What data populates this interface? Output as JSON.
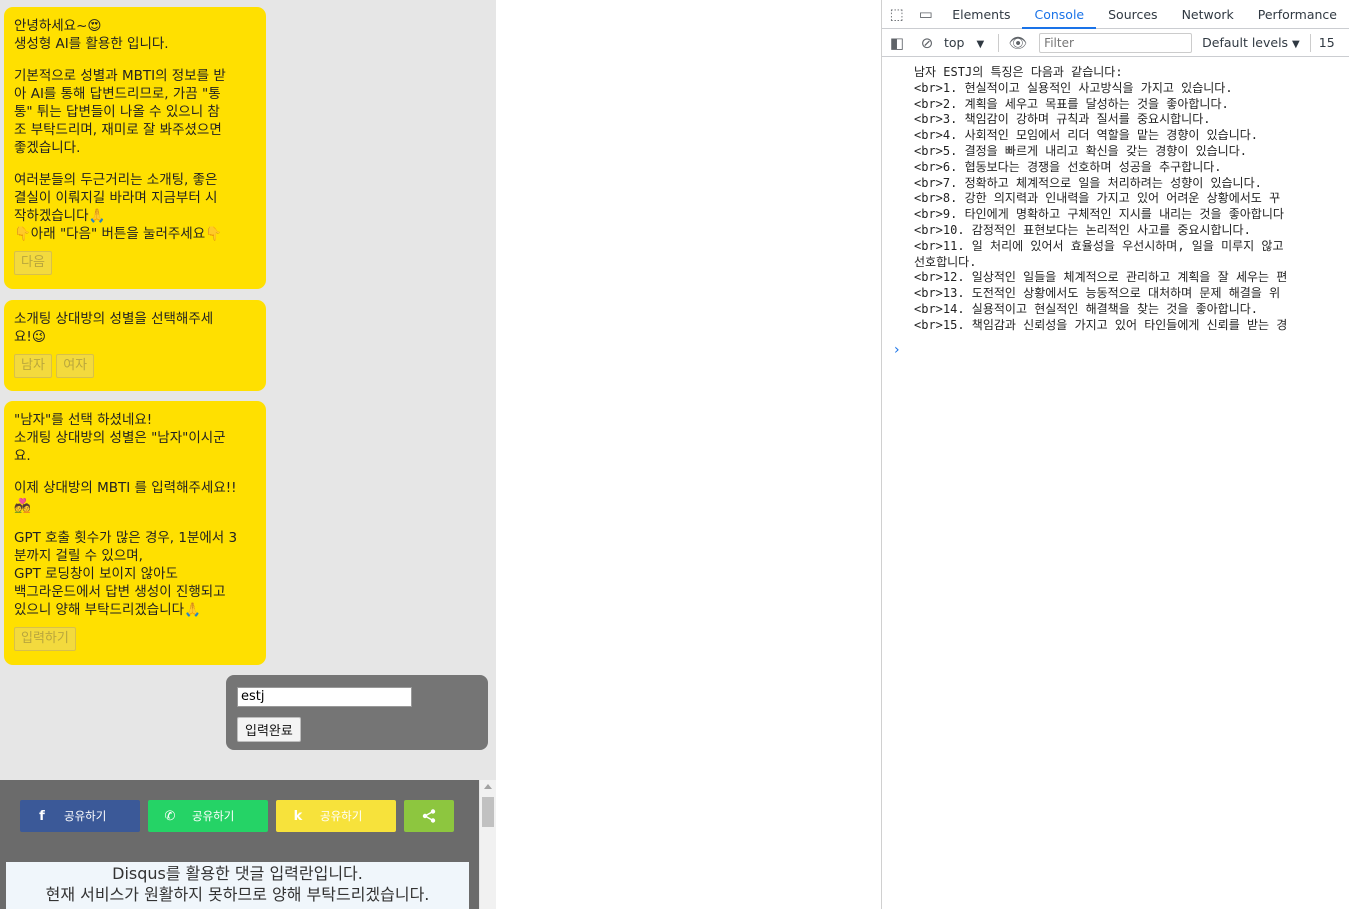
{
  "chat": {
    "b1": {
      "greeting": "안녕하세요~😍",
      "line2": "생성형 AI를 활용한 입니다.",
      "para2": "기본적으로 성별과 MBTI의 정보를 받\n아 AI를 통해 답변드리므로, 가끔 \"통\n통\" 튀는 답변들이 나올 수 있으니 참\n조 부탁드리며, 재미로 잘 봐주셨으면\n좋겠습니다.",
      "para3": "여러분들의 두근거리는 소개팅, 좋은\n결실이 이뤄지길 바라며 지금부터 시\n작하겠습니다🙏\n👇아래 \"다음\" 버튼을 눌러주세요👇",
      "next_button": "다음"
    },
    "b2": {
      "text": "소개팅 상대방의 성별을 선택해주세\n요!😉",
      "male_button": "남자",
      "female_button": "여자"
    },
    "b3": {
      "para1": "\"남자\"를 선택 하셨네요!\n소개팅 상대방의 성별은 \"남자\"이시군\n요.",
      "para2": "이제 상대방의 MBTI 를 입력해주세요!!\n💑",
      "para3": "GPT 호출 횟수가 많은 경우, 1분에서 3\n분까지 걸릴 수 있으며,\nGPT 로딩창이 보이지 않아도\n백그라운드에서 답변 생성이 진행되고\n있으니 양해 부탁드리겠습니다🙏",
      "input_button": "입력하기"
    },
    "reply": {
      "input_value": "estj",
      "submit_label": "입력완료"
    }
  },
  "share": {
    "facebook_label": "공유하기",
    "whatsapp_label": "공유하기",
    "kakao_label": "공유하기",
    "facebook_icon": "f",
    "whatsapp_icon": "✆",
    "kakao_icon": "k",
    "share_icon": "⋖"
  },
  "disqus": {
    "line1": "Disqus를 활용한 댓글 입력란입니다.",
    "line2": "현재 서비스가 원활하지 못하므로 양해 부탁드리겠습니다."
  },
  "devtools": {
    "tabs": [
      "Elements",
      "Console",
      "Sources",
      "Network",
      "Performance"
    ],
    "active_tab": "Console",
    "context": "top",
    "filter_placeholder": "Filter",
    "levels": "Default levels",
    "issues_count": "15",
    "console_output": "남자 ESTJ의 특징은 다음과 같습니다:\n<br>1. 현실적이고 실용적인 사고방식을 가지고 있습니다.\n<br>2. 계획을 세우고 목표를 달성하는 것을 좋아합니다.\n<br>3. 책임감이 강하며 규칙과 질서를 중요시합니다.\n<br>4. 사회적인 모임에서 리더 역할을 맡는 경향이 있습니다.\n<br>5. 결정을 빠르게 내리고 확신을 갖는 경향이 있습니다.\n<br>6. 협동보다는 경쟁을 선호하며 성공을 추구합니다.\n<br>7. 정확하고 체계적으로 일을 처리하려는 성향이 있습니다.\n<br>8. 강한 의지력과 인내력을 가지고 있어 어려운 상황에서도 꾸\n<br>9. 타인에게 명확하고 구체적인 지시를 내리는 것을 좋아합니다\n<br>10. 감정적인 표현보다는 논리적인 사고를 중요시합니다.\n<br>11. 일 처리에 있어서 효율성을 우선시하며, 일을 미루지 않고\n선호합니다.\n<br>12. 일상적인 일들을 체계적으로 관리하고 계획을 잘 세우는 편\n<br>13. 도전적인 상황에서도 능동적으로 대처하며 문제 해결을 위\n<br>14. 실용적이고 현실적인 해결책을 찾는 것을 좋아합니다.\n<br>15. 책임감과 신뢰성을 가지고 있어 타인들에게 신뢰를 받는 경"
  }
}
